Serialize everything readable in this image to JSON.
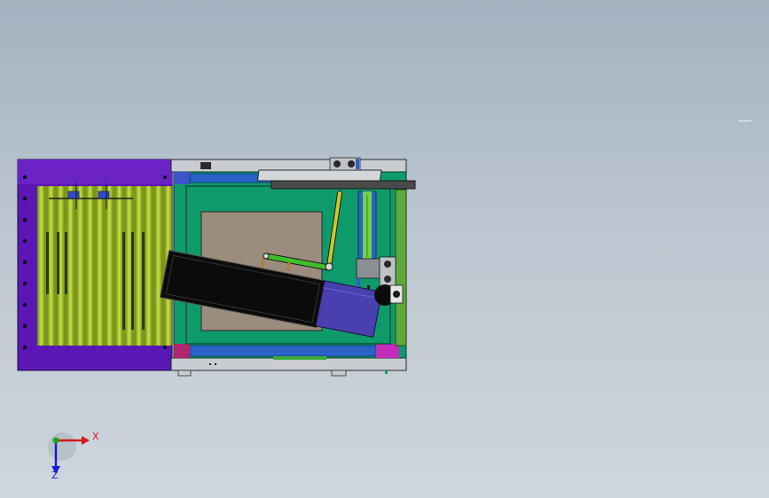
{
  "colors": {
    "background_top": "#a3b1c0",
    "background_bottom": "#cfd6dc",
    "conveyor_frame": "#5a17b5",
    "roller": "#a8c42a",
    "base_frame": "#0f9a6c",
    "plate": "#9c8c7c",
    "tray": "#0b0b0b",
    "gripper": "#4a3fae",
    "rail": "#2a62c8",
    "link_arm": "#3fbf2a",
    "axis_x": "#d11a1a",
    "axis_y": "#1aa81a",
    "axis_z": "#1a1ad1"
  },
  "triad": {
    "x_label": "X",
    "z_label": "Z"
  },
  "icons": [
    "axis-triad-icon"
  ]
}
